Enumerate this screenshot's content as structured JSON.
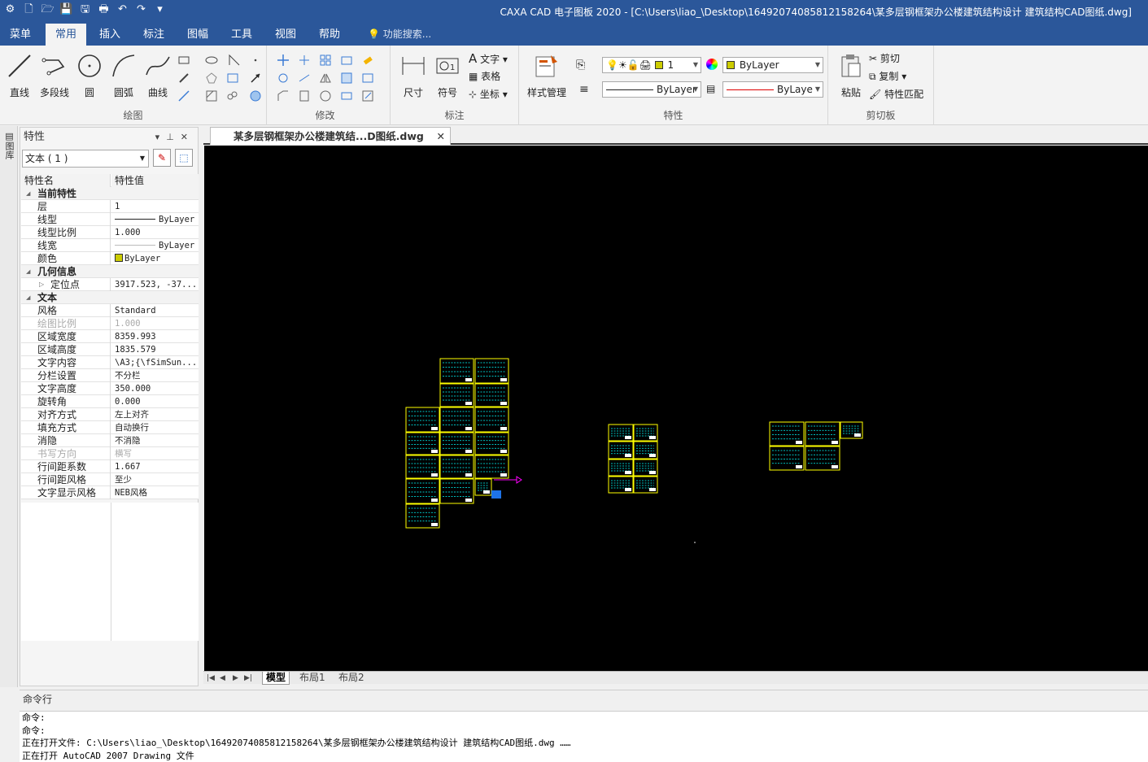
{
  "window": {
    "title": "CAXA CAD 电子图板 2020 - [C:\\Users\\liao_\\Desktop\\16492074085812158264\\某多层钢框架办公楼建筑结构设计 建筑结构CAD图纸.dwg]"
  },
  "ribbon_tabs": [
    "菜单",
    "常用",
    "插入",
    "标注",
    "图幅",
    "工具",
    "视图",
    "帮助"
  ],
  "ribbon_active_tab": "常用",
  "tell_me": "功能搜索...",
  "groups": {
    "draw": {
      "label": "绘图",
      "buttons": [
        "直线",
        "多段线",
        "圆",
        "圆弧",
        "曲线"
      ]
    },
    "modify": {
      "label": "修改"
    },
    "annotate": {
      "label": "标注",
      "buttons": [
        "尺寸",
        "符号"
      ],
      "small": [
        "文字",
        "表格",
        "坐标"
      ]
    },
    "properties": {
      "label": "特性",
      "style_button": "样式管理",
      "layer_value": "1",
      "color_value": "ByLayer",
      "linetype_value": "ByLayer",
      "lineweight_value": "ByLaye"
    },
    "clipboard": {
      "label": "剪切板",
      "paste": "粘贴",
      "small": [
        "剪切",
        "复制",
        "特性匹配"
      ]
    }
  },
  "left_strip_label": "图库",
  "properties_panel": {
    "title": "特性",
    "object_select": "文本 ( 1 )",
    "col_name": "特性名",
    "col_value": "特性值",
    "rows": [
      {
        "type": "cat",
        "k": "当前特性"
      },
      {
        "k": "层",
        "v": "1"
      },
      {
        "k": "线型",
        "v": "ByLayer",
        "glyph": "line"
      },
      {
        "k": "线型比例",
        "v": "1.000"
      },
      {
        "k": "线宽",
        "v": "ByLayer",
        "glyph": "thin"
      },
      {
        "k": "颜色",
        "v": "ByLayer",
        "glyph": "swatch"
      },
      {
        "type": "cat",
        "k": "几何信息"
      },
      {
        "k": "定位点",
        "v": "3917.523, -37...",
        "expand": true
      },
      {
        "type": "cat",
        "k": "文本"
      },
      {
        "k": "风格",
        "v": "Standard"
      },
      {
        "k": "绘图比例",
        "v": "1.000",
        "dim": true
      },
      {
        "k": "区域宽度",
        "v": "8359.993"
      },
      {
        "k": "区域高度",
        "v": "1835.579"
      },
      {
        "k": "文字内容",
        "v": "\\A3;{\\fSimSun..."
      },
      {
        "k": "分栏设置",
        "v": "不分栏"
      },
      {
        "k": "文字高度",
        "v": "350.000"
      },
      {
        "k": "旋转角",
        "v": "0.000"
      },
      {
        "k": "对齐方式",
        "v": "左上对齐"
      },
      {
        "k": "填充方式",
        "v": "自动换行"
      },
      {
        "k": "消隐",
        "v": "不消隐"
      },
      {
        "k": "书写方向",
        "v": "横写",
        "dim": true
      },
      {
        "k": "行间距系数",
        "v": "1.667"
      },
      {
        "k": "行间距风格",
        "v": "至少"
      },
      {
        "k": "文字显示风格",
        "v": "NEB风格"
      }
    ]
  },
  "document_tab": "某多层钢框架办公楼建筑结...D图纸.dwg",
  "layout_tabs": [
    "模型",
    "布局1",
    "布局2"
  ],
  "command": {
    "title": "命令行",
    "lines": [
      "命令:",
      "命令:",
      "正在打开文件: C:\\Users\\liao_\\Desktop\\16492074085812158264\\某多层钢框架办公楼建筑结构设计 建筑结构CAD图纸.dwg ……",
      "正在打开 AutoCAD 2007 Drawing 文件"
    ]
  },
  "colors": {
    "accent": "#2b579a",
    "canvas": "#000000",
    "sheet_border": "#ffff00",
    "drawing_lines": "#00ffff"
  }
}
